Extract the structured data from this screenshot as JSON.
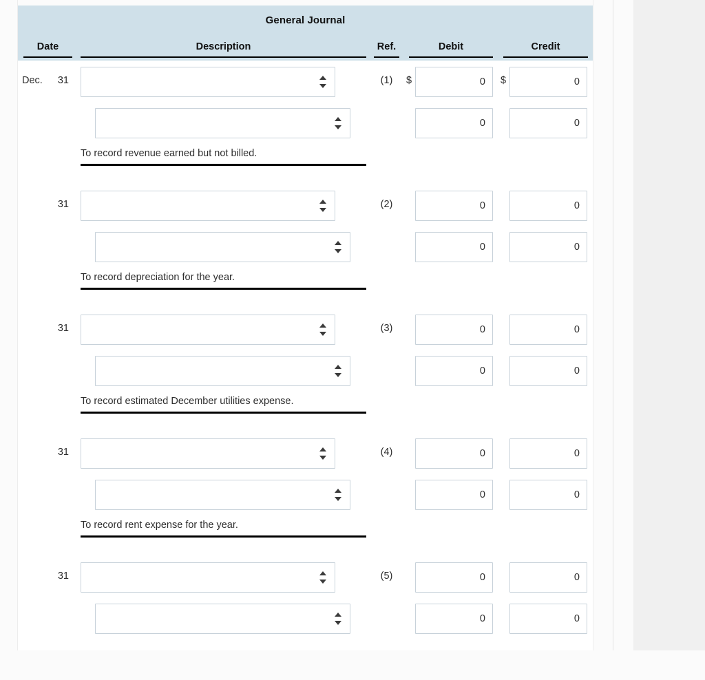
{
  "journal": {
    "title": "General Journal",
    "columns": {
      "date": "Date",
      "description": "Description",
      "ref": "Ref.",
      "debit": "Debit",
      "credit": "Credit"
    },
    "colors": {
      "header_background": "#cfe0e9",
      "panel_background": "#ffffff",
      "page_background": "#fbfbfb",
      "right_strip_background": "#f0f0f0",
      "input_border": "#c8d2da",
      "rule": "#000000",
      "text": "#2d2d2d"
    },
    "currency_symbol": "$",
    "select_placeholder": "",
    "entries": [
      {
        "month": "Dec.",
        "day": "31",
        "ref": "(1)",
        "memo": "To record revenue earned but not billed.",
        "show_currency_symbol": true,
        "lines": [
          {
            "account": "",
            "debit": "0",
            "credit": "0"
          },
          {
            "account": "",
            "debit": "0",
            "credit": "0"
          }
        ]
      },
      {
        "month": "",
        "day": "31",
        "ref": "(2)",
        "memo": "To record depreciation for the year.",
        "show_currency_symbol": false,
        "lines": [
          {
            "account": "",
            "debit": "0",
            "credit": "0"
          },
          {
            "account": "",
            "debit": "0",
            "credit": "0"
          }
        ]
      },
      {
        "month": "",
        "day": "31",
        "ref": "(3)",
        "memo": "To record estimated December utilities expense.",
        "show_currency_symbol": false,
        "lines": [
          {
            "account": "",
            "debit": "0",
            "credit": "0"
          },
          {
            "account": "",
            "debit": "0",
            "credit": "0"
          }
        ]
      },
      {
        "month": "",
        "day": "31",
        "ref": "(4)",
        "memo": "To record rent expense for the year.",
        "show_currency_symbol": false,
        "lines": [
          {
            "account": "",
            "debit": "0",
            "credit": "0"
          },
          {
            "account": "",
            "debit": "0",
            "credit": "0"
          }
        ]
      },
      {
        "month": "",
        "day": "31",
        "ref": "(5)",
        "memo": "",
        "show_currency_symbol": false,
        "lines": [
          {
            "account": "",
            "debit": "0",
            "credit": "0"
          },
          {
            "account": "",
            "debit": "0",
            "credit": "0"
          }
        ]
      }
    ]
  }
}
